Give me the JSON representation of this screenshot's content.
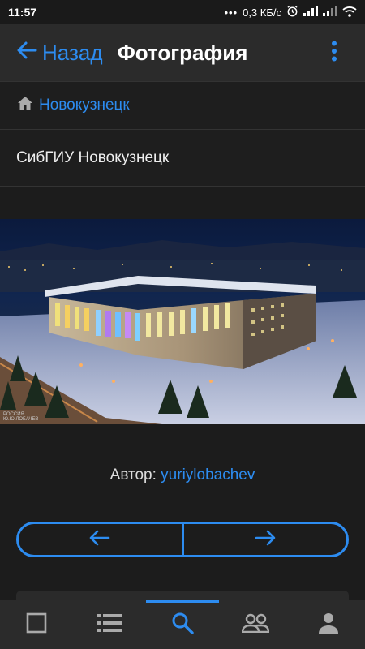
{
  "status_bar": {
    "time": "11:57",
    "dots": "•••",
    "network_speed": "0,3 КБ/с",
    "alarm_icon": "alarm-icon",
    "signal_icon": "signal-icon",
    "wifi_icon": "wifi-icon"
  },
  "app_bar": {
    "back_label": "Назад",
    "title": "Фотография",
    "menu_icon": "more-vert-icon"
  },
  "breadcrumb": {
    "icon": "home-icon",
    "label": "Новокузнецк"
  },
  "photo": {
    "caption": "СибГИУ Новокузнецк",
    "watermark": "РОССИЯ.\nЮ.Ю.ЛОБАЧЕВ"
  },
  "author": {
    "label": "Автор: ",
    "name": "yuriylobachev"
  },
  "pager": {
    "prev_icon": "arrow-left-icon",
    "next_icon": "arrow-right-icon"
  },
  "bottom_nav": {
    "items": [
      {
        "icon": "square-icon",
        "active": false
      },
      {
        "icon": "list-icon",
        "active": false
      },
      {
        "icon": "search-icon",
        "active": true
      },
      {
        "icon": "people-icon",
        "active": false
      },
      {
        "icon": "person-icon",
        "active": false
      }
    ]
  },
  "colors": {
    "accent": "#2d8cf0",
    "background": "#1c1c1c",
    "bar": "#2b2b2b"
  }
}
